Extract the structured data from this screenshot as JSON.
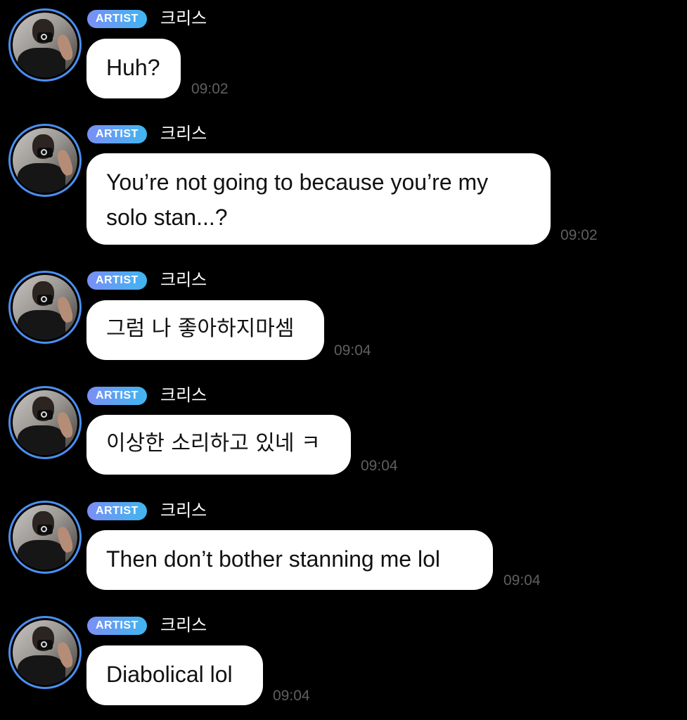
{
  "badge_label": "ARTIST",
  "sender_name": "크리스",
  "messages": [
    {
      "text": "Huh?",
      "time": "09:02"
    },
    {
      "text": "You’re not going to because you’re my\nsolo stan...?",
      "time": "09:02"
    },
    {
      "text": "그럼 나 좋아하지마셈",
      "time": "09:04"
    },
    {
      "text": "이상한 소리하고 있네 ㅋ",
      "time": "09:04"
    },
    {
      "text": "Then don’t bother stanning me lol",
      "time": "09:04"
    },
    {
      "text": "Diabolical lol",
      "time": "09:04"
    }
  ],
  "colors": {
    "background": "#000000",
    "bubble": "#ffffff",
    "avatar_ring": "#4a8ff0",
    "badge_start": "#7a8ff5",
    "badge_end": "#3fb6f0",
    "timestamp": "#5f5f5f"
  },
  "icons": {
    "avatar": "profile-photo"
  }
}
